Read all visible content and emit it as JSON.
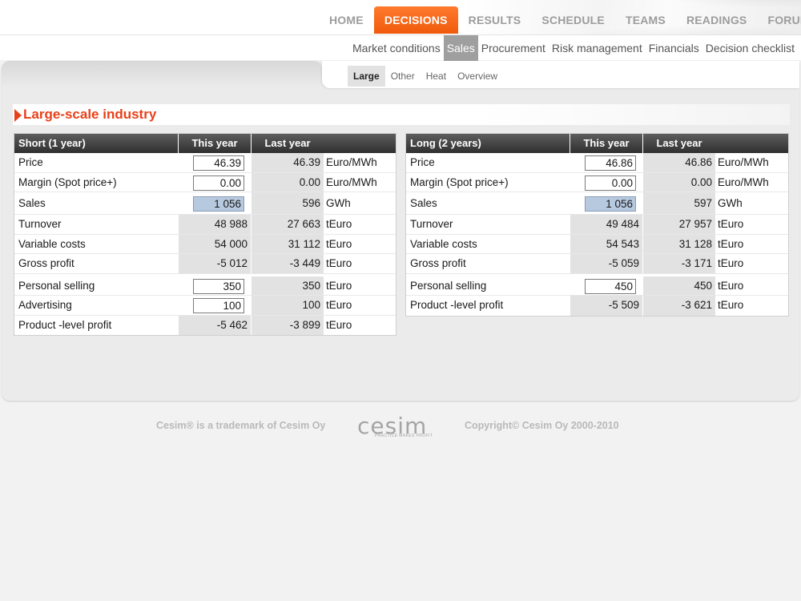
{
  "main_nav": [
    "HOME",
    "DECISIONS",
    "RESULTS",
    "SCHEDULE",
    "TEAMS",
    "READINGS",
    "FORUMS"
  ],
  "main_nav_active": "DECISIONS",
  "sub_nav": [
    "Market conditions",
    "Sales",
    "Procurement",
    "Risk management",
    "Financials",
    "Decision checklist"
  ],
  "sub_nav_active": "Sales",
  "tertiary_tabs": [
    "Large",
    "Other",
    "Heat",
    "Overview"
  ],
  "tertiary_active": "Large",
  "section_title": "Large-scale industry",
  "short": {
    "header": {
      "label": "Short (1 year)",
      "this_year": "This year",
      "last_year": "Last year"
    },
    "rows": [
      {
        "label": "Price",
        "this_year": "46.39",
        "last_year": "46.39",
        "unit": "Euro/MWh",
        "input": true
      },
      {
        "label": "Margin (Spot price+)",
        "this_year": "0.00",
        "last_year": "0.00",
        "unit": "Euro/MWh",
        "input": true
      },
      {
        "label": "Sales",
        "this_year": "1 056",
        "last_year": "596",
        "unit": "GWh",
        "input": "highlight"
      },
      {
        "label": "Turnover",
        "this_year": "48 988",
        "last_year": "27 663",
        "unit": "tEuro"
      },
      {
        "label": "Variable costs",
        "this_year": "54 000",
        "last_year": "31 112",
        "unit": "tEuro"
      },
      {
        "label": "Gross profit",
        "this_year": "-5 012",
        "last_year": "-3 449",
        "unit": "tEuro"
      },
      {
        "label": "Personal selling",
        "this_year": "350",
        "last_year": "350",
        "unit": "tEuro",
        "input": true
      },
      {
        "label": "Advertising",
        "this_year": "100",
        "last_year": "100",
        "unit": "tEuro",
        "input": true
      },
      {
        "label": "Product -level profit",
        "this_year": "-5 462",
        "last_year": "-3 899",
        "unit": "tEuro"
      }
    ]
  },
  "long": {
    "header": {
      "label": "Long (2 years)",
      "this_year": "This year",
      "last_year": "Last year"
    },
    "rows": [
      {
        "label": "Price",
        "this_year": "46.86",
        "last_year": "46.86",
        "unit": "Euro/MWh",
        "input": true
      },
      {
        "label": "Margin (Spot price+)",
        "this_year": "0.00",
        "last_year": "0.00",
        "unit": "Euro/MWh",
        "input": true
      },
      {
        "label": "Sales",
        "this_year": "1 056",
        "last_year": "597",
        "unit": "GWh",
        "input": "highlight"
      },
      {
        "label": "Turnover",
        "this_year": "49 484",
        "last_year": "27 957",
        "unit": "tEuro"
      },
      {
        "label": "Variable costs",
        "this_year": "54 543",
        "last_year": "31 128",
        "unit": "tEuro"
      },
      {
        "label": "Gross profit",
        "this_year": "-5 059",
        "last_year": "-3 171",
        "unit": "tEuro"
      },
      {
        "label": "Personal selling",
        "this_year": "450",
        "last_year": "450",
        "unit": "tEuro",
        "input": true
      },
      {
        "label": "Product -level profit",
        "this_year": "-5 509",
        "last_year": "-3 621",
        "unit": "tEuro"
      }
    ]
  },
  "footer": {
    "left": "Cesim® is a trademark of Cesim Oy",
    "logo_word": "cesim",
    "logo_tagline": "PRACTICE MAKES PROFIT",
    "right": "Copyright© Cesim Oy 2000-2010"
  },
  "colors": {
    "accent": "#f05a0c",
    "title": "#e8401a",
    "input_highlight": "#b7c9df"
  }
}
